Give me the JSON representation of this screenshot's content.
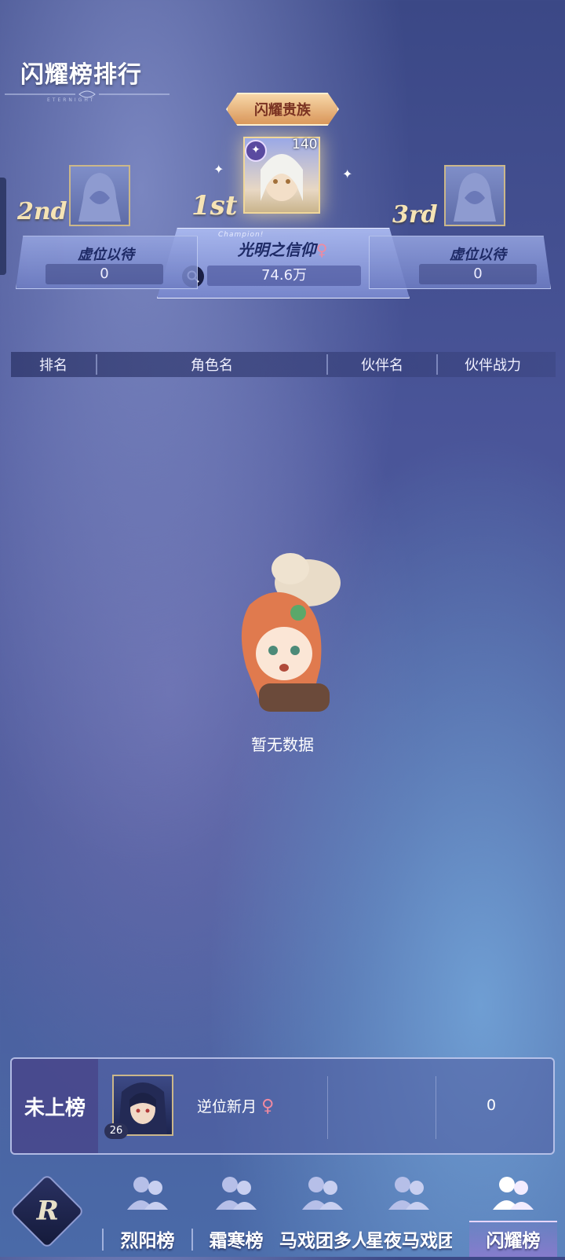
{
  "page_title": "闪耀榜排行",
  "page_subtitle": "ETERNIGHT",
  "podium": {
    "badge": "闪耀贵族",
    "first": {
      "place": "1st",
      "caption": "Champion!",
      "level": "140",
      "name": "光明之信仰",
      "gender": "♀",
      "value": "74.6万"
    },
    "second": {
      "place": "2nd",
      "name": "虚位以待",
      "value": "0"
    },
    "third": {
      "place": "3rd",
      "name": "虚位以待",
      "value": "0"
    }
  },
  "table": {
    "headers": [
      "排名",
      "角色名",
      "伙伴名",
      "伙伴战力"
    ],
    "empty_text": "暂无数据"
  },
  "my_rank": {
    "rank_label": "未上榜",
    "level": "26",
    "name": "逆位新月",
    "gender": "♀",
    "partner": "",
    "power": "0"
  },
  "nav": {
    "items": [
      {
        "label": "烈阳榜",
        "active": false
      },
      {
        "label": "霜寒榜",
        "active": false
      },
      {
        "label": "马戏团多人",
        "active": false
      },
      {
        "label": "星夜马戏团",
        "active": false
      },
      {
        "label": "闪耀榜",
        "active": true
      }
    ]
  },
  "colors": {
    "female_symbol": "#f08aa0",
    "gold": "#f5e3b5",
    "active_tab": "#ffffff"
  }
}
